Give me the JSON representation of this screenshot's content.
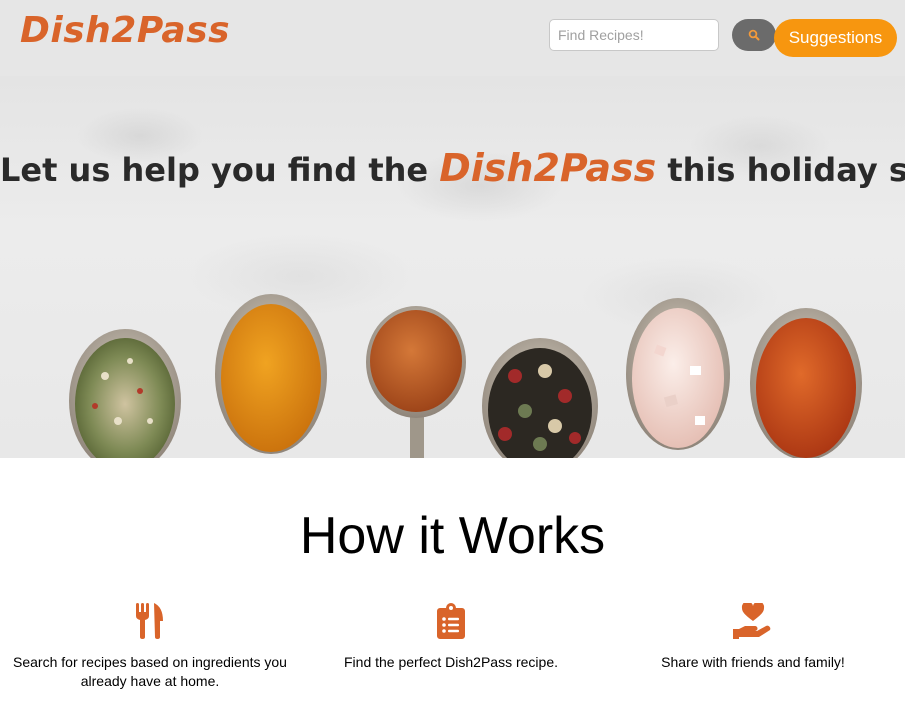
{
  "navbar": {
    "brand": "Dish2Pass",
    "search": {
      "placeholder": "Find Recipes!",
      "value": ""
    },
    "search_button_icon": "search-icon",
    "suggestions_label": "Suggestions"
  },
  "hero": {
    "headline_prefix": "Let us help you find the",
    "headline_brand": "Dish2Pass",
    "headline_suffix": "this holiday season!",
    "spoons": [
      "dried-herbs-spoon",
      "turmeric-spoon",
      "paprika-spoon",
      "peppercorn-spoon",
      "pink-salt-spoon",
      "chili-powder-spoon"
    ]
  },
  "how_it_works": {
    "title": "How it Works",
    "steps": [
      {
        "icon": "utensils-icon",
        "text": "Search for recipes based on ingredients you already have at home."
      },
      {
        "icon": "clipboard-list-icon",
        "text": "Find the perfect Dish2Pass recipe."
      },
      {
        "icon": "hand-heart-icon",
        "text": "Share with friends and family!"
      }
    ]
  },
  "colors": {
    "brand": "#d9642a",
    "accent": "#f7960f",
    "navbar_bg": "#e6e6e6",
    "search_button": "#6b6b6b"
  }
}
